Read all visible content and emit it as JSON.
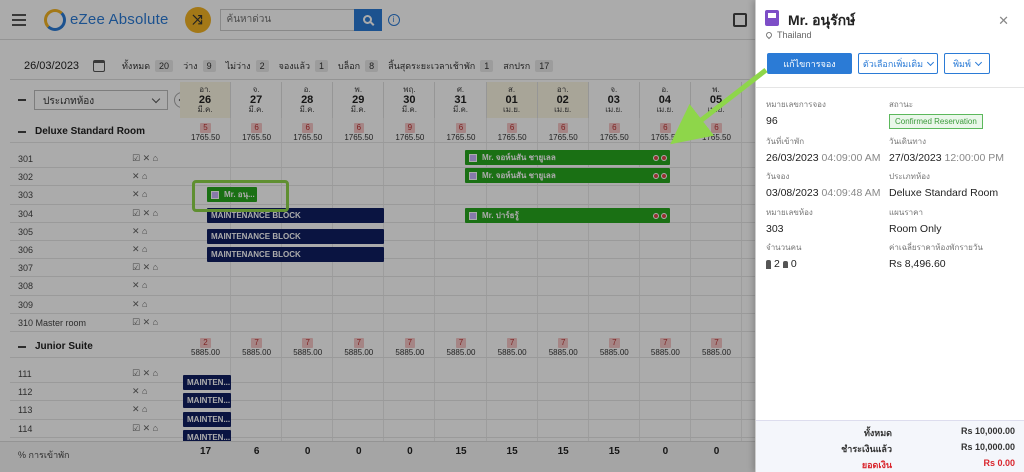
{
  "app": {
    "title": "eZee Absolute",
    "search_placeholder": "ค้นหาด่วน"
  },
  "filter": {
    "date": "26/03/2023",
    "counts": [
      {
        "label": "ทั้งหมด",
        "value": "20"
      },
      {
        "label": "ว่าง",
        "value": "9"
      },
      {
        "label": "ไม่ว่าง",
        "value": "2"
      },
      {
        "label": "จองแล้ว",
        "value": "1"
      },
      {
        "label": "บล็อก",
        "value": "8"
      },
      {
        "label": "สิ้นสุดระยะเวลาเช้าพัก",
        "value": "1"
      },
      {
        "label": "สกปรก",
        "value": "17"
      }
    ]
  },
  "grid": {
    "room_type_select": "ประเภทห้อง",
    "days": [
      {
        "dow": "อา.",
        "day": "26",
        "month": "มี.ค.",
        "weekend": true
      },
      {
        "dow": "จ.",
        "day": "27",
        "month": "มี.ค.",
        "weekend": false
      },
      {
        "dow": "อ.",
        "day": "28",
        "month": "มี.ค.",
        "weekend": false
      },
      {
        "dow": "พ.",
        "day": "29",
        "month": "มี.ค.",
        "weekend": false
      },
      {
        "dow": "พฤ.",
        "day": "30",
        "month": "มี.ค.",
        "weekend": false
      },
      {
        "dow": "ศ.",
        "day": "31",
        "month": "มี.ค.",
        "weekend": false
      },
      {
        "dow": "ส.",
        "day": "01",
        "month": "เม.ย.",
        "weekend": true
      },
      {
        "dow": "อา.",
        "day": "02",
        "month": "เม.ย.",
        "weekend": true
      },
      {
        "dow": "จ.",
        "day": "03",
        "month": "เม.ย.",
        "weekend": false
      },
      {
        "dow": "อ.",
        "day": "04",
        "month": "เม.ย.",
        "weekend": false
      },
      {
        "dow": "พ.",
        "day": "05",
        "month": "เม.ย.",
        "weekend": false
      }
    ],
    "categories": [
      {
        "name": "Deluxe Standard Room",
        "avail": [
          "5",
          "6",
          "6",
          "6",
          "9",
          "6",
          "6",
          "6",
          "6",
          "6",
          "6"
        ],
        "rate": "1765.50",
        "rooms": [
          "301",
          "302",
          "303",
          "304",
          "305",
          "306",
          "307",
          "308",
          "309",
          "310 Master room"
        ]
      },
      {
        "name": "Junior Suite",
        "avail": [
          "2",
          "7",
          "7",
          "7",
          "7",
          "7",
          "7",
          "7",
          "7",
          "7",
          "7"
        ],
        "rate": "5885.00",
        "rooms": [
          "111",
          "112",
          "113",
          "114"
        ]
      }
    ],
    "bookings": [
      {
        "label": "Mr. จอห์นสัน ชายูเลล",
        "kind": "green"
      },
      {
        "label": "Mr. จอห์นสัน ชายูเลล",
        "kind": "green"
      },
      {
        "label": "Mr. อนุ...",
        "kind": "green"
      },
      {
        "label": "MAINTENANCE BLOCK",
        "kind": "navy"
      },
      {
        "label": "Mr. ปาร์ธรู้",
        "kind": "green"
      },
      {
        "label": "MAINTENANCE BLOCK",
        "kind": "navy"
      },
      {
        "label": "MAINTENANCE BLOCK",
        "kind": "navy"
      },
      {
        "label": "MAINTEN...",
        "kind": "navy"
      },
      {
        "label": "MAINTEN...",
        "kind": "navy"
      },
      {
        "label": "MAINTEN...",
        "kind": "navy"
      },
      {
        "label": "MAINTEN...",
        "kind": "navy"
      }
    ],
    "occupancy_label": "% การเข้าพัก",
    "occupancy": [
      "17",
      "6",
      "0",
      "0",
      "0",
      "15",
      "15",
      "15",
      "15",
      "0",
      "0"
    ]
  },
  "panel": {
    "guest_name": "Mr. อนุรักษ์",
    "country": "Thailand",
    "buttons": {
      "edit": "แก้ไขการจอง",
      "more": "ตัวเลือกเพิ่มเติม",
      "print": "พิมพ์"
    },
    "fields": {
      "res_no_label": "หมายเลขการจอง",
      "res_no": "96",
      "status_label": "สถานะ",
      "status": "Confirmed Reservation",
      "arrival_label": "วันที่เข้าพัก",
      "arrival_date": "26/03/2023",
      "arrival_time": "04:09:00 AM",
      "departure_label": "วันเดินทาง",
      "departure_date": "27/03/2023",
      "departure_time": "12:00:00 PM",
      "booking_label": "วันจอง",
      "booking_date": "03/08/2023",
      "booking_time": "04:09:48 AM",
      "room_type_label": "ประเภทห้อง",
      "room_type": "Deluxe Standard Room",
      "room_no_label": "หมายเลขห้อง",
      "room_no": "303",
      "rate_plan_label": "แผนราคา",
      "rate_plan": "Room Only",
      "pax_label": "จำนวนคน",
      "adults": "2",
      "children": "0",
      "avg_rate_label": "ค่าเฉลี่ยราคาห้องพักรายวัน",
      "avg_rate": "Rs 8,496.60"
    },
    "totals": {
      "total_label": "ทั้งหมด",
      "total": "Rs 10,000.00",
      "paid_label": "ชำระเงินแล้ว",
      "paid": "Rs 10,000.00",
      "balance_label": "ยอดเงิน",
      "balance": "Rs 0.00"
    }
  },
  "colors": {
    "accent": "#2b7bd6",
    "booking_green": "#28a71e",
    "block_navy": "#0f1e62",
    "highlight": "#8ed64a"
  }
}
